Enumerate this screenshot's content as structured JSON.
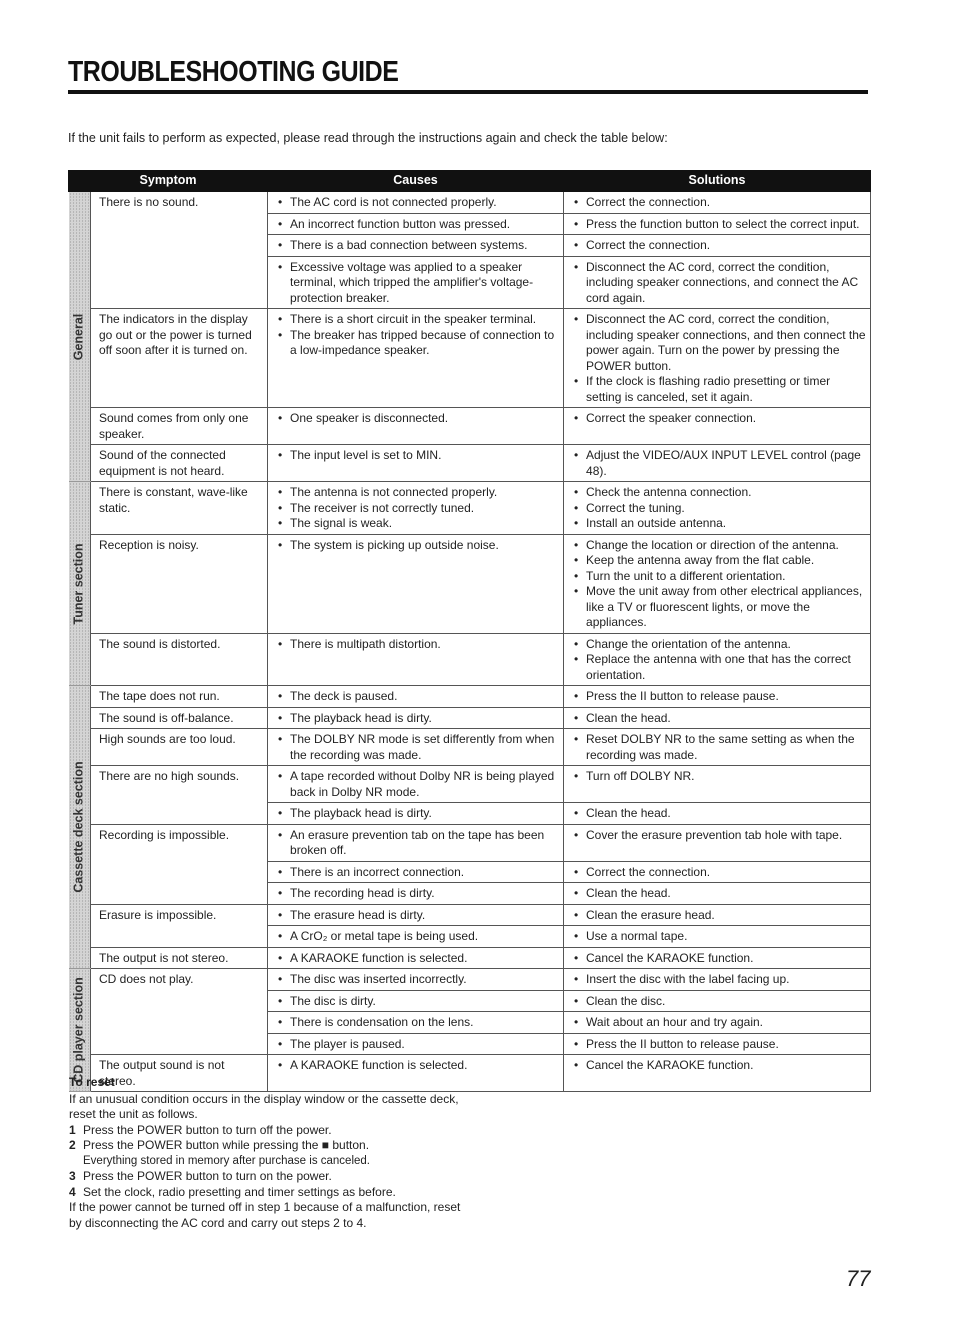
{
  "page": {
    "title": "TROUBLESHOOTING GUIDE",
    "intro": "If the unit fails to perform as expected, please read through the instructions again and check the table below:",
    "page_number": "77"
  },
  "table": {
    "headers": [
      "Symptom",
      "Causes",
      "Solutions"
    ],
    "sections": [
      {
        "label": "General",
        "rows": [
          {
            "symptom": "There is no sound.",
            "causes": [
              "The AC cord is not connected properly."
            ],
            "solutions": [
              "Correct the connection."
            ]
          },
          {
            "symptom": "",
            "causes": [
              "An incorrect function button was pressed."
            ],
            "solutions": [
              "Press the function button to select the correct input."
            ]
          },
          {
            "symptom": "",
            "causes": [
              "There is a bad connection between systems."
            ],
            "solutions": [
              "Correct the connection."
            ]
          },
          {
            "symptom": "",
            "causes": [
              "Excessive voltage was applied to a speaker terminal, which tripped the amplifier's voltage-protection breaker."
            ],
            "solutions": [
              "Disconnect the AC cord, correct the condition, including speaker connections, and connect the AC cord again."
            ]
          },
          {
            "symptom": "The indicators in the display go out or the power is turned off soon after it is turned on.",
            "causes": [
              "There is a short circuit in the speaker terminal.",
              "The breaker has tripped because of connection to a low-impedance speaker."
            ],
            "solutions": [
              "Disconnect the AC cord, correct the condition, including speaker connections, and then connect the power again. Turn on the power by pressing the POWER button.",
              "If the clock is flashing radio presetting or timer setting is canceled, set it again."
            ]
          },
          {
            "symptom": "Sound comes from only one speaker.",
            "causes": [
              "One speaker is disconnected."
            ],
            "solutions": [
              "Correct the speaker connection."
            ]
          },
          {
            "symptom": "Sound of the connected equipment is not heard.",
            "causes": [
              "The input level is set to MIN."
            ],
            "solutions": [
              "Adjust the VIDEO/AUX INPUT LEVEL control (page 48)."
            ]
          }
        ]
      },
      {
        "label": "Tuner section",
        "rows": [
          {
            "symptom": "There is constant, wave-like static.",
            "causes": [
              "The antenna is not connected properly.",
              "The receiver is not correctly tuned.",
              "The signal is weak."
            ],
            "solutions": [
              "Check the antenna connection.",
              "Correct the tuning.",
              "Install an outside antenna."
            ]
          },
          {
            "symptom": "Reception is noisy.",
            "causes": [
              "The system is picking up outside noise."
            ],
            "solutions": [
              "Change the location or direction of the antenna.",
              "Keep the antenna away from the flat cable.",
              "Turn the unit to a different orientation.",
              "Move the unit away from other electrical appliances, like a TV or fluorescent lights, or move the appliances."
            ]
          },
          {
            "symptom": "The sound is distorted.",
            "causes": [
              "There is multipath distortion."
            ],
            "solutions": [
              "Change the orientation of the antenna.",
              "Replace the antenna with one that has the correct orientation."
            ]
          }
        ]
      },
      {
        "label": "Cassette deck section",
        "rows": [
          {
            "symptom": "The tape does not run.",
            "causes": [
              "The deck is paused."
            ],
            "solutions": [
              "Press the II button to release pause."
            ]
          },
          {
            "symptom": "The sound is off-balance.",
            "causes": [
              "The playback head is dirty."
            ],
            "solutions": [
              "Clean the head."
            ]
          },
          {
            "symptom": "High sounds are too loud.",
            "causes": [
              "The DOLBY NR mode is set differently from when the recording was made."
            ],
            "solutions": [
              "Reset DOLBY NR to the same setting as when the recording was made."
            ]
          },
          {
            "symptom": "There are no high sounds.",
            "causes": [
              "A tape recorded without Dolby NR is being played back in Dolby NR mode."
            ],
            "solutions": [
              "Turn off DOLBY NR."
            ]
          },
          {
            "symptom": "",
            "causes": [
              "The playback head is dirty."
            ],
            "solutions": [
              "Clean the head."
            ]
          },
          {
            "symptom": "Recording is impossible.",
            "causes": [
              "An erasure prevention tab on the tape has been broken off."
            ],
            "solutions": [
              "Cover the erasure prevention tab hole with tape."
            ]
          },
          {
            "symptom": "",
            "causes": [
              "There is an incorrect connection."
            ],
            "solutions": [
              "Correct the connection."
            ]
          },
          {
            "symptom": "",
            "causes": [
              "The recording head is dirty."
            ],
            "solutions": [
              "Clean the head."
            ]
          },
          {
            "symptom": "Erasure is impossible.",
            "causes": [
              "The erasure head is dirty."
            ],
            "solutions": [
              "Clean the erasure head."
            ]
          },
          {
            "symptom": "",
            "causes": [
              "A CrO₂ or metal tape is being used."
            ],
            "solutions": [
              "Use a normal tape."
            ]
          },
          {
            "symptom": "The output is not stereo.",
            "causes": [
              "A KARAOKE function is selected."
            ],
            "solutions": [
              "Cancel the KARAOKE function."
            ]
          }
        ]
      },
      {
        "label": "CD player section",
        "rows": [
          {
            "symptom": "CD does not play.",
            "causes": [
              "The disc was inserted incorrectly."
            ],
            "solutions": [
              "Insert the disc with the label facing up."
            ]
          },
          {
            "symptom": "",
            "causes": [
              "The disc is dirty."
            ],
            "solutions": [
              "Clean the disc."
            ]
          },
          {
            "symptom": "",
            "causes": [
              "There is condensation on the lens."
            ],
            "solutions": [
              "Wait about an hour and try again."
            ]
          },
          {
            "symptom": "",
            "causes": [
              "The player is paused."
            ],
            "solutions": [
              "Press the II button to release pause."
            ]
          },
          {
            "symptom": "The output sound is not stereo.",
            "causes": [
              "A KARAOKE function is selected."
            ],
            "solutions": [
              "Cancel the KARAOKE function."
            ]
          }
        ]
      }
    ]
  },
  "reset": {
    "heading": "To reset",
    "intro": "If an unusual condition occurs in the display window or the cassette deck, reset the unit as follows.",
    "steps": [
      {
        "num": "1",
        "text": "Press the POWER button to turn off the power.",
        "note": ""
      },
      {
        "num": "2",
        "text": "Press the POWER button while pressing the ■ button.",
        "note": "Everything stored in memory after purchase is canceled."
      },
      {
        "num": "3",
        "text": "Press the POWER button to turn on the power.",
        "note": ""
      },
      {
        "num": "4",
        "text": "Set the clock, radio presetting and timer settings as before.",
        "note": ""
      }
    ],
    "outro": "If the power cannot be turned off in step 1 because of  a malfunction, reset by disconnecting the AC cord and carry out steps 2 to 4."
  }
}
